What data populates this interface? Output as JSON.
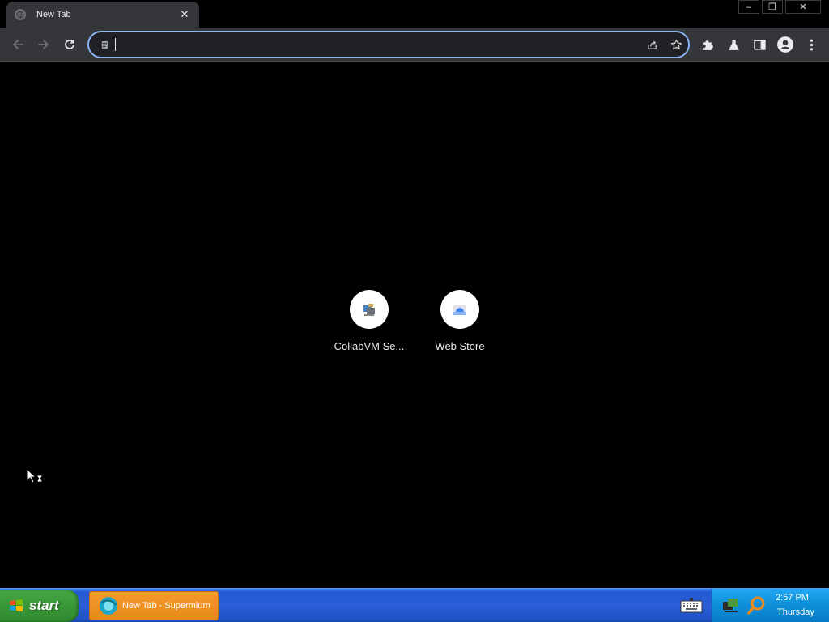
{
  "browser": {
    "tab": {
      "title": "New Tab",
      "close_glyph": "✕",
      "favicon": "globe-icon"
    },
    "window_controls": {
      "minimize": "–",
      "restore": "❐",
      "close": "✕"
    },
    "toolbar": {
      "back_icon": "arrow-left-icon",
      "forward_icon": "arrow-right-icon",
      "reload_icon": "reload-icon",
      "omnibox": {
        "value": "",
        "placeholder": "",
        "site_icon": "site-info-icon",
        "share_icon": "share-icon",
        "bookmark_icon": "star-icon"
      },
      "right_tools": [
        "puzzle-icon",
        "flask-icon",
        "side-panel-icon",
        "profile-icon",
        "more-icon"
      ]
    },
    "accent": "#8ab4f8"
  },
  "new_tab": {
    "shortcuts": [
      {
        "label": "CollabVM Se...",
        "icon": "collabvm-icon"
      },
      {
        "label": "Web Store",
        "icon": "web-store-icon"
      }
    ]
  },
  "taskbar": {
    "start_label": "start",
    "tasks": [
      {
        "label": "New Tab - Supermium",
        "icon": "supermium-icon"
      }
    ],
    "clock": {
      "time": "2:57 PM",
      "day": "Thursday"
    }
  }
}
